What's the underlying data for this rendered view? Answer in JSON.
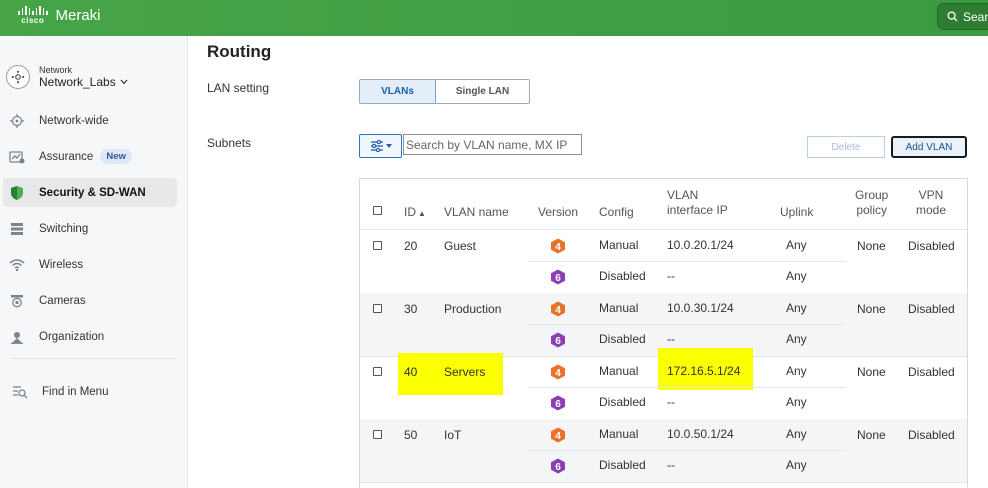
{
  "brand": {
    "cisco": "cisco",
    "product": "Meraki"
  },
  "header": {
    "search_label": "Search"
  },
  "sidebar": {
    "network_label": "Network",
    "network_name": "Network_Labs",
    "items": [
      {
        "label": "Network-wide",
        "icon": "network-wide-icon"
      },
      {
        "label": "Assurance",
        "icon": "assurance-icon",
        "badge": "New"
      },
      {
        "label": "Security & SD-WAN",
        "icon": "security-shield-icon",
        "active": true
      },
      {
        "label": "Switching",
        "icon": "switch-icon"
      },
      {
        "label": "Wireless",
        "icon": "wifi-icon"
      },
      {
        "label": "Cameras",
        "icon": "camera-icon"
      },
      {
        "label": "Organization",
        "icon": "organization-icon"
      }
    ],
    "find_in_menu": "Find in Menu"
  },
  "page": {
    "title": "Routing",
    "lan_setting_label": "LAN setting",
    "lan_options": [
      "VLANs",
      "Single LAN"
    ],
    "lan_selected": "VLANs",
    "subnets_label": "Subnets",
    "search_placeholder": "Search by VLAN name, MX IP",
    "delete_label": "Delete",
    "add_vlan_label": "Add VLAN"
  },
  "table": {
    "headers": {
      "id": "ID",
      "sort_indicator": "▲",
      "vlan_name": "VLAN name",
      "version": "Version",
      "config": "Config",
      "vlan_ip_1": "VLAN",
      "vlan_ip_2": "interface IP",
      "uplink": "Uplink",
      "group_1": "Group",
      "group_2": "policy",
      "vpn_1": "VPN",
      "vpn_2": "mode"
    },
    "rows": [
      {
        "id": "20",
        "name": "Guest",
        "v4_config": "Manual",
        "v4_ip": "10.0.20.1/24",
        "v4_uplink": "Any",
        "v6_config": "Disabled",
        "v6_ip": "--",
        "v6_uplink": "Any",
        "group_policy": "None",
        "vpn_mode": "Disabled"
      },
      {
        "id": "30",
        "name": "Production",
        "v4_config": "Manual",
        "v4_ip": "10.0.30.1/24",
        "v4_uplink": "Any",
        "v6_config": "Disabled",
        "v6_ip": "--",
        "v6_uplink": "Any",
        "group_policy": "None",
        "vpn_mode": "Disabled"
      },
      {
        "id": "40",
        "name": "Servers",
        "v4_config": "Manual",
        "v4_ip": "172.16.5.1/24",
        "v4_uplink": "Any",
        "v6_config": "Disabled",
        "v6_ip": "--",
        "v6_uplink": "Any",
        "group_policy": "None",
        "vpn_mode": "Disabled",
        "highlighted": true
      },
      {
        "id": "50",
        "name": "IoT",
        "v4_config": "Manual",
        "v4_ip": "10.0.50.1/24",
        "v4_uplink": "Any",
        "v6_config": "Disabled",
        "v6_ip": "--",
        "v6_uplink": "Any",
        "group_policy": "None",
        "vpn_mode": "Disabled"
      }
    ],
    "version_icons": {
      "v4": "4",
      "v6": "6"
    }
  },
  "colors": {
    "header_green": "#47a548",
    "ipv4_orange": "#e8742b",
    "ipv6_purple": "#8a3fb5",
    "highlight": "#fbff00",
    "link_blue": "#1b5fa8"
  }
}
